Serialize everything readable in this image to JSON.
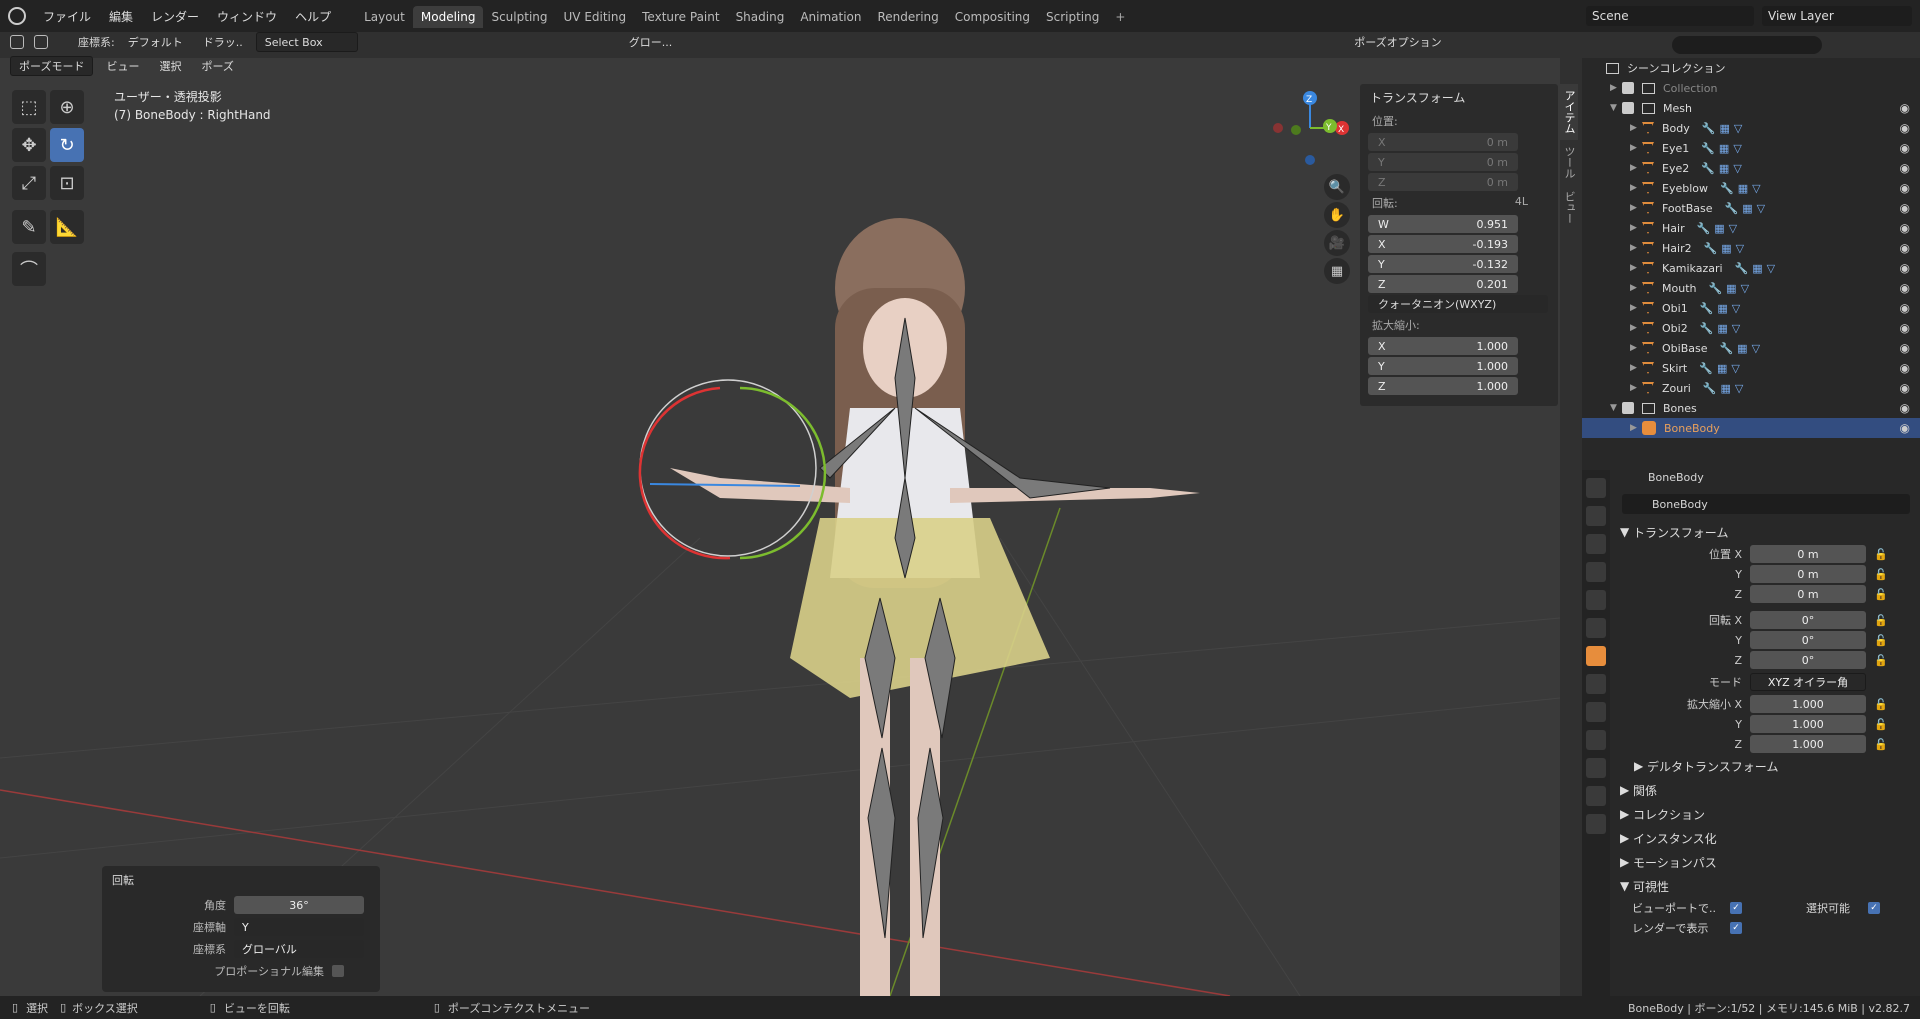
{
  "menu": [
    "ファイル",
    "編集",
    "レンダー",
    "ウィンドウ",
    "ヘルプ"
  ],
  "workspace_tabs": [
    {
      "label": "Layout",
      "active": false
    },
    {
      "label": "Modeling",
      "active": true
    },
    {
      "label": "Sculpting",
      "active": false
    },
    {
      "label": "UV Editing",
      "active": false
    },
    {
      "label": "Texture Paint",
      "active": false
    },
    {
      "label": "Shading",
      "active": false
    },
    {
      "label": "Animation",
      "active": false
    },
    {
      "label": "Rendering",
      "active": false
    },
    {
      "label": "Compositing",
      "active": false
    },
    {
      "label": "Scripting",
      "active": false
    }
  ],
  "scene": "Scene",
  "view_layer": "View Layer",
  "header": {
    "coord_label": "座標系:",
    "coord_value": "デフォルト",
    "drag_label": "ドラッ..",
    "select_mode": "Select Box",
    "transform_orient": "グロー...",
    "pose_options": "ポーズオプション",
    "mode": "ポーズモード",
    "view": "ビュー",
    "select": "選択",
    "pose": "ポーズ"
  },
  "viewport": {
    "projection": "ユーザー・透視投影",
    "active": "(7) BoneBody : RightHand"
  },
  "npanel": {
    "title": "トランスフォーム",
    "location_label": "位置:",
    "location": [
      [
        "X",
        "0 m"
      ],
      [
        "Y",
        "0 m"
      ],
      [
        "Z",
        "0 m"
      ]
    ],
    "rotation_label": "回転:",
    "rotation_mode_short": "4L",
    "rotation": [
      [
        "W",
        "0.951"
      ],
      [
        "X",
        "-0.193"
      ],
      [
        "Y",
        "-0.132"
      ],
      [
        "Z",
        "0.201"
      ]
    ],
    "rotation_mode": "クォータニオン(WXYZ)",
    "scale_label": "拡大縮小:",
    "scale": [
      [
        "X",
        "1.000"
      ],
      [
        "Y",
        "1.000"
      ],
      [
        "Z",
        "1.000"
      ]
    ],
    "tabs": [
      "アイテム",
      "ツール",
      "ビュー"
    ]
  },
  "gizmo_axes": {
    "x": "X",
    "y": "Y",
    "z": "Z"
  },
  "operator": {
    "title": "回転",
    "angle_label": "角度",
    "angle": "36°",
    "axis_label": "座標軸",
    "axis": "Y",
    "orient_label": "座標系",
    "orient": "グローバル",
    "prop_label": "プロポーショナル編集"
  },
  "outliner": {
    "root": "シーンコレクション",
    "collection": "Collection",
    "mesh": "Mesh",
    "objects": [
      "Body",
      "Eye1",
      "Eye2",
      "Eyeblow",
      "FootBase",
      "Hair",
      "Hair2",
      "Kamikazari",
      "Mouth",
      "Obi1",
      "Obi2",
      "ObiBase",
      "Skirt",
      "Zouri"
    ],
    "bones": "Bones",
    "bonebody": "BoneBody"
  },
  "props": {
    "object_name": "BoneBody",
    "data_name": "BoneBody",
    "transform": "トランスフォーム",
    "loc_label": "位置",
    "loc": [
      [
        "X",
        "0 m"
      ],
      [
        "Y",
        "0 m"
      ],
      [
        "Z",
        "0 m"
      ]
    ],
    "rot_label": "回転",
    "rot": [
      [
        "X",
        "0°"
      ],
      [
        "Y",
        "0°"
      ],
      [
        "Z",
        "0°"
      ]
    ],
    "mode_label": "モード",
    "mode_value": "XYZ オイラー角",
    "scale_label": "拡大縮小",
    "scale": [
      [
        "X",
        "1.000"
      ],
      [
        "Y",
        "1.000"
      ],
      [
        "Z",
        "1.000"
      ]
    ],
    "delta": "デルタトランスフォーム",
    "sections": [
      "関係",
      "コレクション",
      "インスタンス化",
      "モーションパス"
    ],
    "visibility": "可視性",
    "vis_viewport": "ビューポートで..",
    "vis_selectable": "選択可能",
    "vis_render": "レンダーで表示"
  },
  "status": {
    "select": "選択",
    "box": "ボックス選択",
    "rotate_view": "ビューを回転",
    "context": "ポーズコンテクストメニュー",
    "info": "BoneBody | ボーン:1/52 | メモリ:145.6 MiB | v2.82.7"
  },
  "colors": {
    "accent": "#4772b3",
    "selected_row": "#334d80",
    "object_orange": "#e78d3c"
  }
}
